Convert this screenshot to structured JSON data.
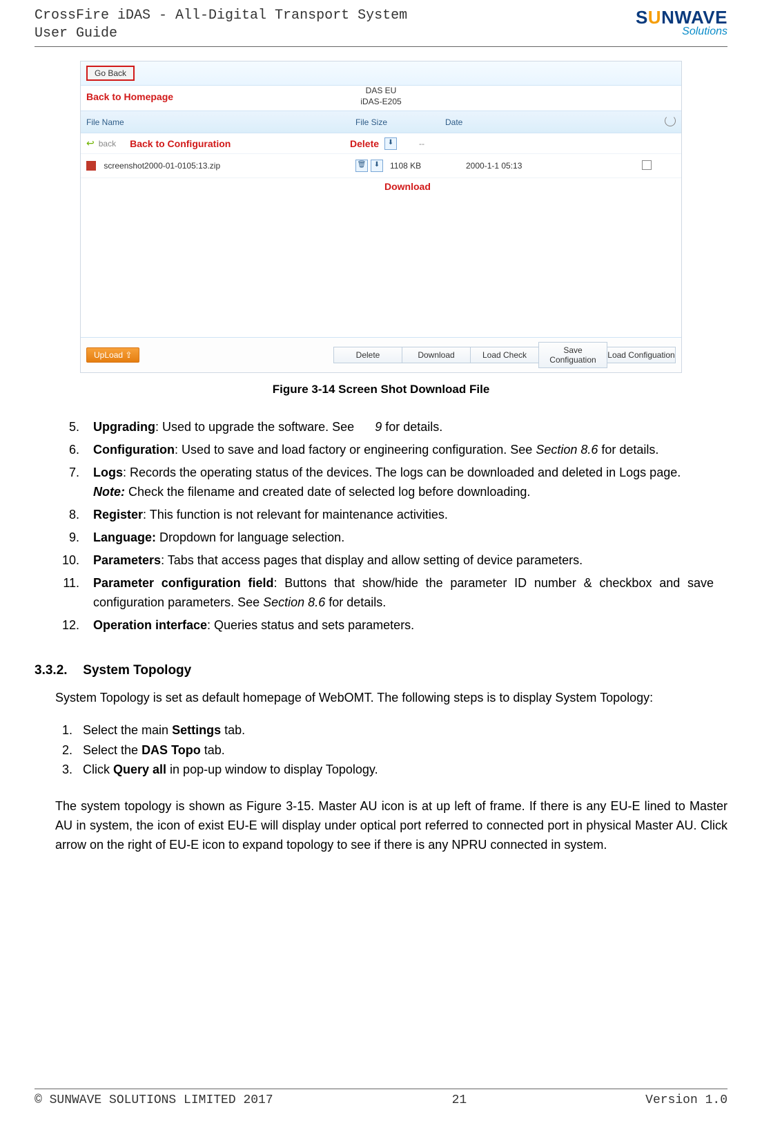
{
  "header": {
    "line1": "CrossFire iDAS - All-Digital Transport System",
    "line2": "User Guide",
    "logo_main_pre": "S",
    "logo_main_sun": "U",
    "logo_main_post": "NWAVE",
    "logo_sub": "Solutions"
  },
  "screenshot": {
    "go_back": "Go Back",
    "go_back_annot": "Back to Homepage",
    "center_line1": "DAS EU",
    "center_line2": "iDAS-E205",
    "head_name": "File Name",
    "head_size": "File Size",
    "head_date": "Date",
    "back_link": "back",
    "back_annot": "Back to Configuration",
    "delete_annot": "Delete",
    "file_name": "screenshot2000-01-0105:13.zip",
    "file_size": "1108 KB",
    "file_date": "2000-1-1 05:13",
    "download_annot": "Download",
    "upload": "UpLoad ⇪",
    "btn_delete": "Delete",
    "btn_download": "Download",
    "btn_loadcheck": "Load Check",
    "btn_savecfg": "Save Configuation",
    "btn_loadcfg": "Load Configuation"
  },
  "figcap": "Figure 3-14 Screen Shot Download File",
  "list": {
    "start": 5,
    "i5_b": "Upgrading",
    "i5_a": ": Used to upgrade the software. See",
    "i5_gap": "      ",
    "i5_ref": "9",
    "i5_c": " for details.",
    "i6_b": "Configuration",
    "i6_a": ": Used to save and load factory or engineering configuration. See ",
    "i6_ref": "Section 8.6",
    "i6_c": " for details.",
    "i7_b": "Logs",
    "i7_a": ": Records the operating status of the devices. The logs can be downloaded and deleted in Logs page.",
    "i7_note_b": "Note:",
    "i7_note_a": " Check the filename and created date of selected log before downloading.",
    "i8_b": "Register",
    "i8_a": ": This function is not relevant for maintenance activities.",
    "i9_b": "Language:",
    "i9_a": " Dropdown for language selection.",
    "i10_b": "Parameters",
    "i10_a": ": Tabs that access pages that display and allow setting of device parameters.",
    "i11_b": "Parameter configuration field",
    "i11_a": ": Buttons that show/hide the parameter ID number & checkbox and save configuration parameters. See ",
    "i11_ref": "Section 8.6",
    "i11_c": " for details.",
    "i12_b": "Operation interface",
    "i12_a": ": Queries status and sets parameters."
  },
  "section332": {
    "num": "3.3.2.",
    "title": "System Topology",
    "intro": "System Topology is set as default homepage of WebOMT. The following steps is to display System Topology:",
    "s1a": "Select the main ",
    "s1b": "Settings",
    "s1c": " tab.",
    "s2a": "Select the ",
    "s2b": "DAS Topo",
    "s2c": " tab.",
    "s3a": "Click ",
    "s3b": "Query all",
    "s3c": " in pop-up window to display Topology.",
    "para2": "The system topology is shown as Figure 3-15. Master AU icon is at up left of frame. If there is any EU-E lined to Master AU in system, the icon of exist EU-E will display under optical port referred to connected port in physical Master AU. Click arrow on the right of EU-E icon to expand topology to see if there is any NPRU connected in system."
  },
  "footer": {
    "left": "© SUNWAVE SOLUTIONS LIMITED 2017",
    "center": "21",
    "right": "Version 1.0"
  }
}
